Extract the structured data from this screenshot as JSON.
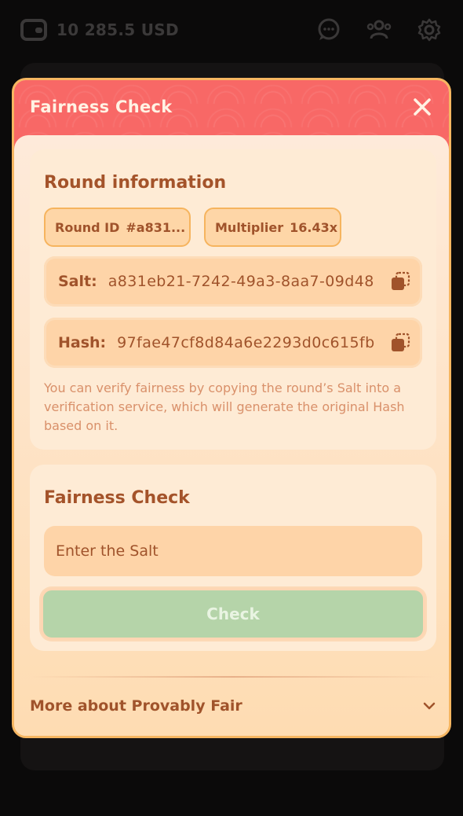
{
  "header": {
    "balance": "10 285.5 USD",
    "icons": [
      "wallet-icon",
      "chat-icon",
      "users-icon",
      "gear-icon"
    ]
  },
  "modal": {
    "title": "Fairness Check",
    "close_icon": "close-icon",
    "round_info": {
      "heading": "Round information",
      "round_id_label": "Round ID",
      "round_id_value": "#a831...",
      "multiplier_label": "Multiplier",
      "multiplier_value": "16.43x",
      "salt_label": "Salt:",
      "salt_value": "a831eb21-7242-49a3-8aa7-09d48",
      "hash_label": "Hash:",
      "hash_value": "97fae47cf8d84a6e2293d0c615fb",
      "note": "You can verify fairness by copying the round’s Salt into a verification service, which will generate the original Hash based on it."
    },
    "fairness_check": {
      "heading": "Fairness Check",
      "placeholder": "Enter the Salt",
      "button_label": "Check"
    },
    "more_label": "More about Provably Fair"
  },
  "colors": {
    "header_red": "#f86866",
    "accent_brown": "#a0532b",
    "check_green": "#b5d4a9",
    "border_orange": "#f6b661"
  }
}
